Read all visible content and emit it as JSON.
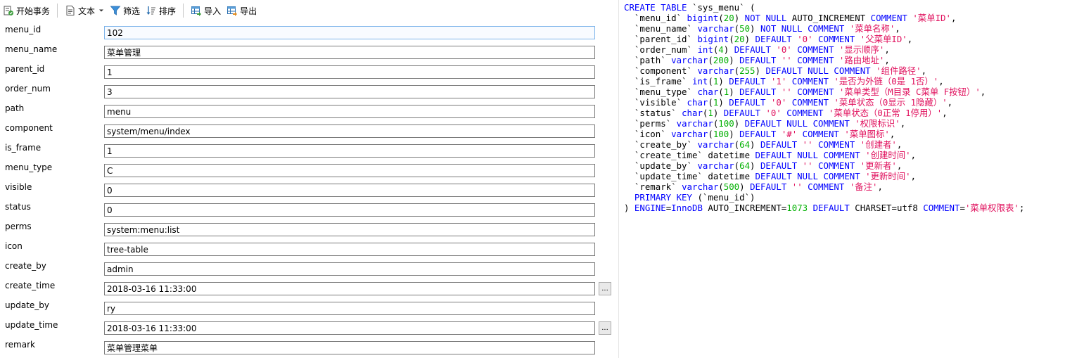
{
  "toolbar": {
    "begin_transaction": "开始事务",
    "text": "文本",
    "filter": "筛选",
    "sort": "排序",
    "import": "导入",
    "export": "导出"
  },
  "fields": [
    {
      "name": "menu_id",
      "value": "102"
    },
    {
      "name": "menu_name",
      "value": "菜单管理"
    },
    {
      "name": "parent_id",
      "value": "1"
    },
    {
      "name": "order_num",
      "value": "3"
    },
    {
      "name": "path",
      "value": "menu"
    },
    {
      "name": "component",
      "value": "system/menu/index"
    },
    {
      "name": "is_frame",
      "value": "1"
    },
    {
      "name": "menu_type",
      "value": "C"
    },
    {
      "name": "visible",
      "value": "0"
    },
    {
      "name": "status",
      "value": "0"
    },
    {
      "name": "perms",
      "value": "system:menu:list"
    },
    {
      "name": "icon",
      "value": "tree-table"
    },
    {
      "name": "create_by",
      "value": "admin"
    },
    {
      "name": "create_time",
      "value": "2018-03-16 11:33:00"
    },
    {
      "name": "update_by",
      "value": "ry"
    },
    {
      "name": "update_time",
      "value": "2018-03-16 11:33:00"
    },
    {
      "name": "remark",
      "value": "菜单管理菜单"
    }
  ],
  "ellipsis_label": "...",
  "sql": [
    [
      [
        "kw",
        "CREATE TABLE "
      ],
      [
        "plain",
        "`sys_menu` ("
      ]
    ],
    [
      [
        "plain",
        "  `menu_id` "
      ],
      [
        "kw",
        "bigint"
      ],
      [
        "plain",
        "("
      ],
      [
        "num",
        "20"
      ],
      [
        "plain",
        ") "
      ],
      [
        "kw",
        "NOT NULL "
      ],
      [
        "plain",
        "AUTO_INCREMENT "
      ],
      [
        "kw",
        "COMMENT "
      ],
      [
        "str",
        "'菜单ID'"
      ],
      [
        "plain",
        ","
      ]
    ],
    [
      [
        "plain",
        "  `menu_name` "
      ],
      [
        "kw",
        "varchar"
      ],
      [
        "plain",
        "("
      ],
      [
        "num",
        "50"
      ],
      [
        "plain",
        ") "
      ],
      [
        "kw",
        "NOT NULL COMMENT "
      ],
      [
        "str",
        "'菜单名称'"
      ],
      [
        "plain",
        ","
      ]
    ],
    [
      [
        "plain",
        "  `parent_id` "
      ],
      [
        "kw",
        "bigint"
      ],
      [
        "plain",
        "("
      ],
      [
        "num",
        "20"
      ],
      [
        "plain",
        ") "
      ],
      [
        "kw",
        "DEFAULT "
      ],
      [
        "str",
        "'0'"
      ],
      [
        "kw",
        " COMMENT "
      ],
      [
        "str",
        "'父菜单ID'"
      ],
      [
        "plain",
        ","
      ]
    ],
    [
      [
        "plain",
        "  `order_num` "
      ],
      [
        "kw",
        "int"
      ],
      [
        "plain",
        "("
      ],
      [
        "num",
        "4"
      ],
      [
        "plain",
        ") "
      ],
      [
        "kw",
        "DEFAULT "
      ],
      [
        "str",
        "'0'"
      ],
      [
        "kw",
        " COMMENT "
      ],
      [
        "str",
        "'显示顺序'"
      ],
      [
        "plain",
        ","
      ]
    ],
    [
      [
        "plain",
        "  `path` "
      ],
      [
        "kw",
        "varchar"
      ],
      [
        "plain",
        "("
      ],
      [
        "num",
        "200"
      ],
      [
        "plain",
        ") "
      ],
      [
        "kw",
        "DEFAULT "
      ],
      [
        "str",
        "''"
      ],
      [
        "kw",
        " COMMENT "
      ],
      [
        "str",
        "'路由地址'"
      ],
      [
        "plain",
        ","
      ]
    ],
    [
      [
        "plain",
        "  `component` "
      ],
      [
        "kw",
        "varchar"
      ],
      [
        "plain",
        "("
      ],
      [
        "num",
        "255"
      ],
      [
        "plain",
        ") "
      ],
      [
        "kw",
        "DEFAULT NULL COMMENT "
      ],
      [
        "str",
        "'组件路径'"
      ],
      [
        "plain",
        ","
      ]
    ],
    [
      [
        "plain",
        "  `is_frame` "
      ],
      [
        "kw",
        "int"
      ],
      [
        "plain",
        "("
      ],
      [
        "num",
        "1"
      ],
      [
        "plain",
        ") "
      ],
      [
        "kw",
        "DEFAULT "
      ],
      [
        "str",
        "'1'"
      ],
      [
        "kw",
        " COMMENT "
      ],
      [
        "str",
        "'是否为外链（0是 1否）'"
      ],
      [
        "plain",
        ","
      ]
    ],
    [
      [
        "plain",
        "  `menu_type` "
      ],
      [
        "kw",
        "char"
      ],
      [
        "plain",
        "("
      ],
      [
        "num",
        "1"
      ],
      [
        "plain",
        ") "
      ],
      [
        "kw",
        "DEFAULT "
      ],
      [
        "str",
        "''"
      ],
      [
        "kw",
        " COMMENT "
      ],
      [
        "str",
        "'菜单类型（M目录 C菜单 F按钮）'"
      ],
      [
        "plain",
        ","
      ]
    ],
    [
      [
        "plain",
        "  `visible` "
      ],
      [
        "kw",
        "char"
      ],
      [
        "plain",
        "("
      ],
      [
        "num",
        "1"
      ],
      [
        "plain",
        ") "
      ],
      [
        "kw",
        "DEFAULT "
      ],
      [
        "str",
        "'0'"
      ],
      [
        "kw",
        " COMMENT "
      ],
      [
        "str",
        "'菜单状态（0显示 1隐藏）'"
      ],
      [
        "plain",
        ","
      ]
    ],
    [
      [
        "plain",
        "  `status` "
      ],
      [
        "kw",
        "char"
      ],
      [
        "plain",
        "("
      ],
      [
        "num",
        "1"
      ],
      [
        "plain",
        ") "
      ],
      [
        "kw",
        "DEFAULT "
      ],
      [
        "str",
        "'0'"
      ],
      [
        "kw",
        " COMMENT "
      ],
      [
        "str",
        "'菜单状态（0正常 1停用）'"
      ],
      [
        "plain",
        ","
      ]
    ],
    [
      [
        "plain",
        "  `perms` "
      ],
      [
        "kw",
        "varchar"
      ],
      [
        "plain",
        "("
      ],
      [
        "num",
        "100"
      ],
      [
        "plain",
        ") "
      ],
      [
        "kw",
        "DEFAULT NULL COMMENT "
      ],
      [
        "str",
        "'权限标识'"
      ],
      [
        "plain",
        ","
      ]
    ],
    [
      [
        "plain",
        "  `icon` "
      ],
      [
        "kw",
        "varchar"
      ],
      [
        "plain",
        "("
      ],
      [
        "num",
        "100"
      ],
      [
        "plain",
        ") "
      ],
      [
        "kw",
        "DEFAULT "
      ],
      [
        "str",
        "'#'"
      ],
      [
        "kw",
        " COMMENT "
      ],
      [
        "str",
        "'菜单图标'"
      ],
      [
        "plain",
        ","
      ]
    ],
    [
      [
        "plain",
        "  `create_by` "
      ],
      [
        "kw",
        "varchar"
      ],
      [
        "plain",
        "("
      ],
      [
        "num",
        "64"
      ],
      [
        "plain",
        ") "
      ],
      [
        "kw",
        "DEFAULT "
      ],
      [
        "str",
        "''"
      ],
      [
        "kw",
        " COMMENT "
      ],
      [
        "str",
        "'创建者'"
      ],
      [
        "plain",
        ","
      ]
    ],
    [
      [
        "plain",
        "  `create_time` datetime "
      ],
      [
        "kw",
        "DEFAULT NULL COMMENT "
      ],
      [
        "str",
        "'创建时间'"
      ],
      [
        "plain",
        ","
      ]
    ],
    [
      [
        "plain",
        "  `update_by` "
      ],
      [
        "kw",
        "varchar"
      ],
      [
        "plain",
        "("
      ],
      [
        "num",
        "64"
      ],
      [
        "plain",
        ") "
      ],
      [
        "kw",
        "DEFAULT "
      ],
      [
        "str",
        "''"
      ],
      [
        "kw",
        " COMMENT "
      ],
      [
        "str",
        "'更新者'"
      ],
      [
        "plain",
        ","
      ]
    ],
    [
      [
        "plain",
        "  `update_time` datetime "
      ],
      [
        "kw",
        "DEFAULT NULL COMMENT "
      ],
      [
        "str",
        "'更新时间'"
      ],
      [
        "plain",
        ","
      ]
    ],
    [
      [
        "plain",
        "  `remark` "
      ],
      [
        "kw",
        "varchar"
      ],
      [
        "plain",
        "("
      ],
      [
        "num",
        "500"
      ],
      [
        "plain",
        ") "
      ],
      [
        "kw",
        "DEFAULT "
      ],
      [
        "str",
        "''"
      ],
      [
        "kw",
        " COMMENT "
      ],
      [
        "str",
        "'备注'"
      ],
      [
        "plain",
        ","
      ]
    ],
    [
      [
        "kw",
        "  PRIMARY KEY "
      ],
      [
        "plain",
        "(`menu_id`)"
      ]
    ],
    [
      [
        "plain",
        ") "
      ],
      [
        "kw",
        "ENGINE"
      ],
      [
        "plain",
        "="
      ],
      [
        "kw",
        "InnoDB "
      ],
      [
        "plain",
        "AUTO_INCREMENT="
      ],
      [
        "num",
        "1073"
      ],
      [
        "kw",
        " DEFAULT "
      ],
      [
        "plain",
        "CHARSET=utf8 "
      ],
      [
        "kw",
        "COMMENT"
      ],
      [
        "plain",
        "="
      ],
      [
        "str",
        "'菜单权限表'"
      ],
      [
        "plain",
        ";"
      ]
    ]
  ]
}
